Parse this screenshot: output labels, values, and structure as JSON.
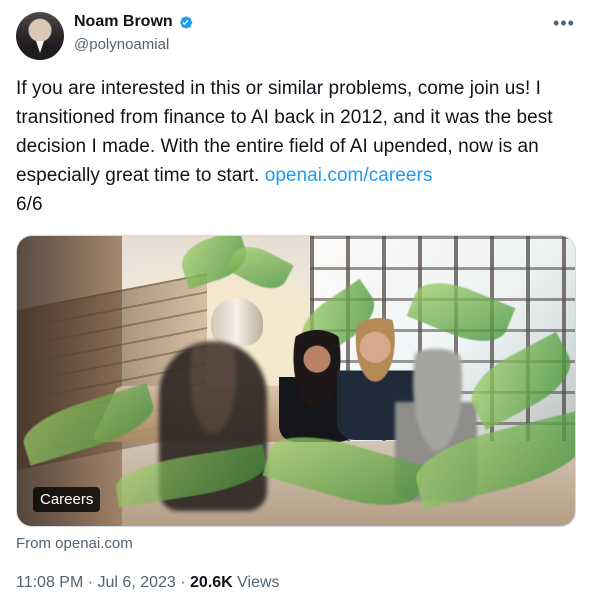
{
  "author": {
    "name": "Noam Brown",
    "handle": "@polynoamial",
    "verified_icon": "verified-badge-icon",
    "accent_color": "#1d9bf0"
  },
  "tweet": {
    "text_before_link": "If you are interested in this or similar problems, come join us! I transitioned from finance to AI back in 2012, and it was the best decision I made. With the entire field of AI upended, now is an especially great time to start. ",
    "link_text": "openai.com/careers",
    "text_after_link": "\n6/6"
  },
  "media": {
    "badge_label": "Careers",
    "source": "From openai.com"
  },
  "meta": {
    "time": "11:08 PM",
    "separator_1": " · ",
    "date": "Jul 6, 2023",
    "separator_2": " · ",
    "views_count": "20.6K",
    "views_label": " Views"
  },
  "icons": {
    "more": "more-icon",
    "verified": "verified-icon"
  },
  "colors": {
    "text": "#0f1419",
    "secondary": "#536471",
    "link": "#1d9bf0",
    "border": "#cfd9de"
  }
}
